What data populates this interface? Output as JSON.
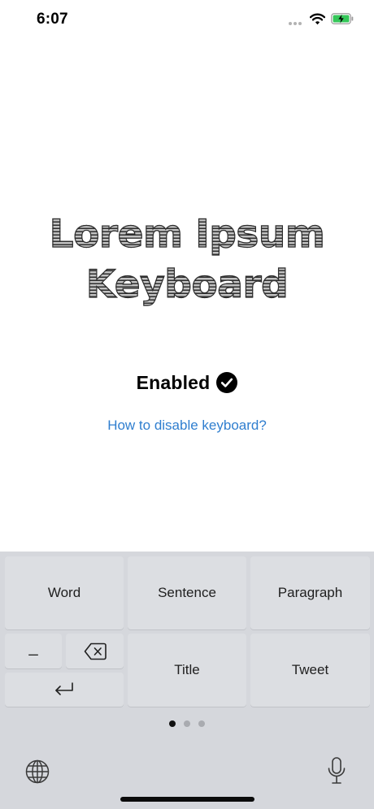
{
  "status_bar": {
    "time": "6:07"
  },
  "hero": {
    "line1": "Lorem Ipsum",
    "line2": "Keyboard"
  },
  "status": {
    "enabled_label": "Enabled"
  },
  "help_link": "How to disable keyboard?",
  "keyboard": {
    "keys": {
      "word": "Word",
      "sentence": "Sentence",
      "paragraph": "Paragraph",
      "space": "_",
      "title": "Title",
      "tweet": "Tweet"
    },
    "page_count": 3,
    "current_page": 1
  },
  "icons": {
    "wifi": "wifi-icon",
    "battery": "battery-charging-icon",
    "check": "checkmark-circle-icon",
    "delete": "delete-backward-icon",
    "return": "return-icon",
    "globe": "globe-icon",
    "mic": "microphone-icon"
  },
  "colors": {
    "link": "#2f7ecf",
    "battery_fill": "#35c759",
    "keyboard_bg": "#d5d7dc",
    "key_bg": "#dcdee2"
  }
}
